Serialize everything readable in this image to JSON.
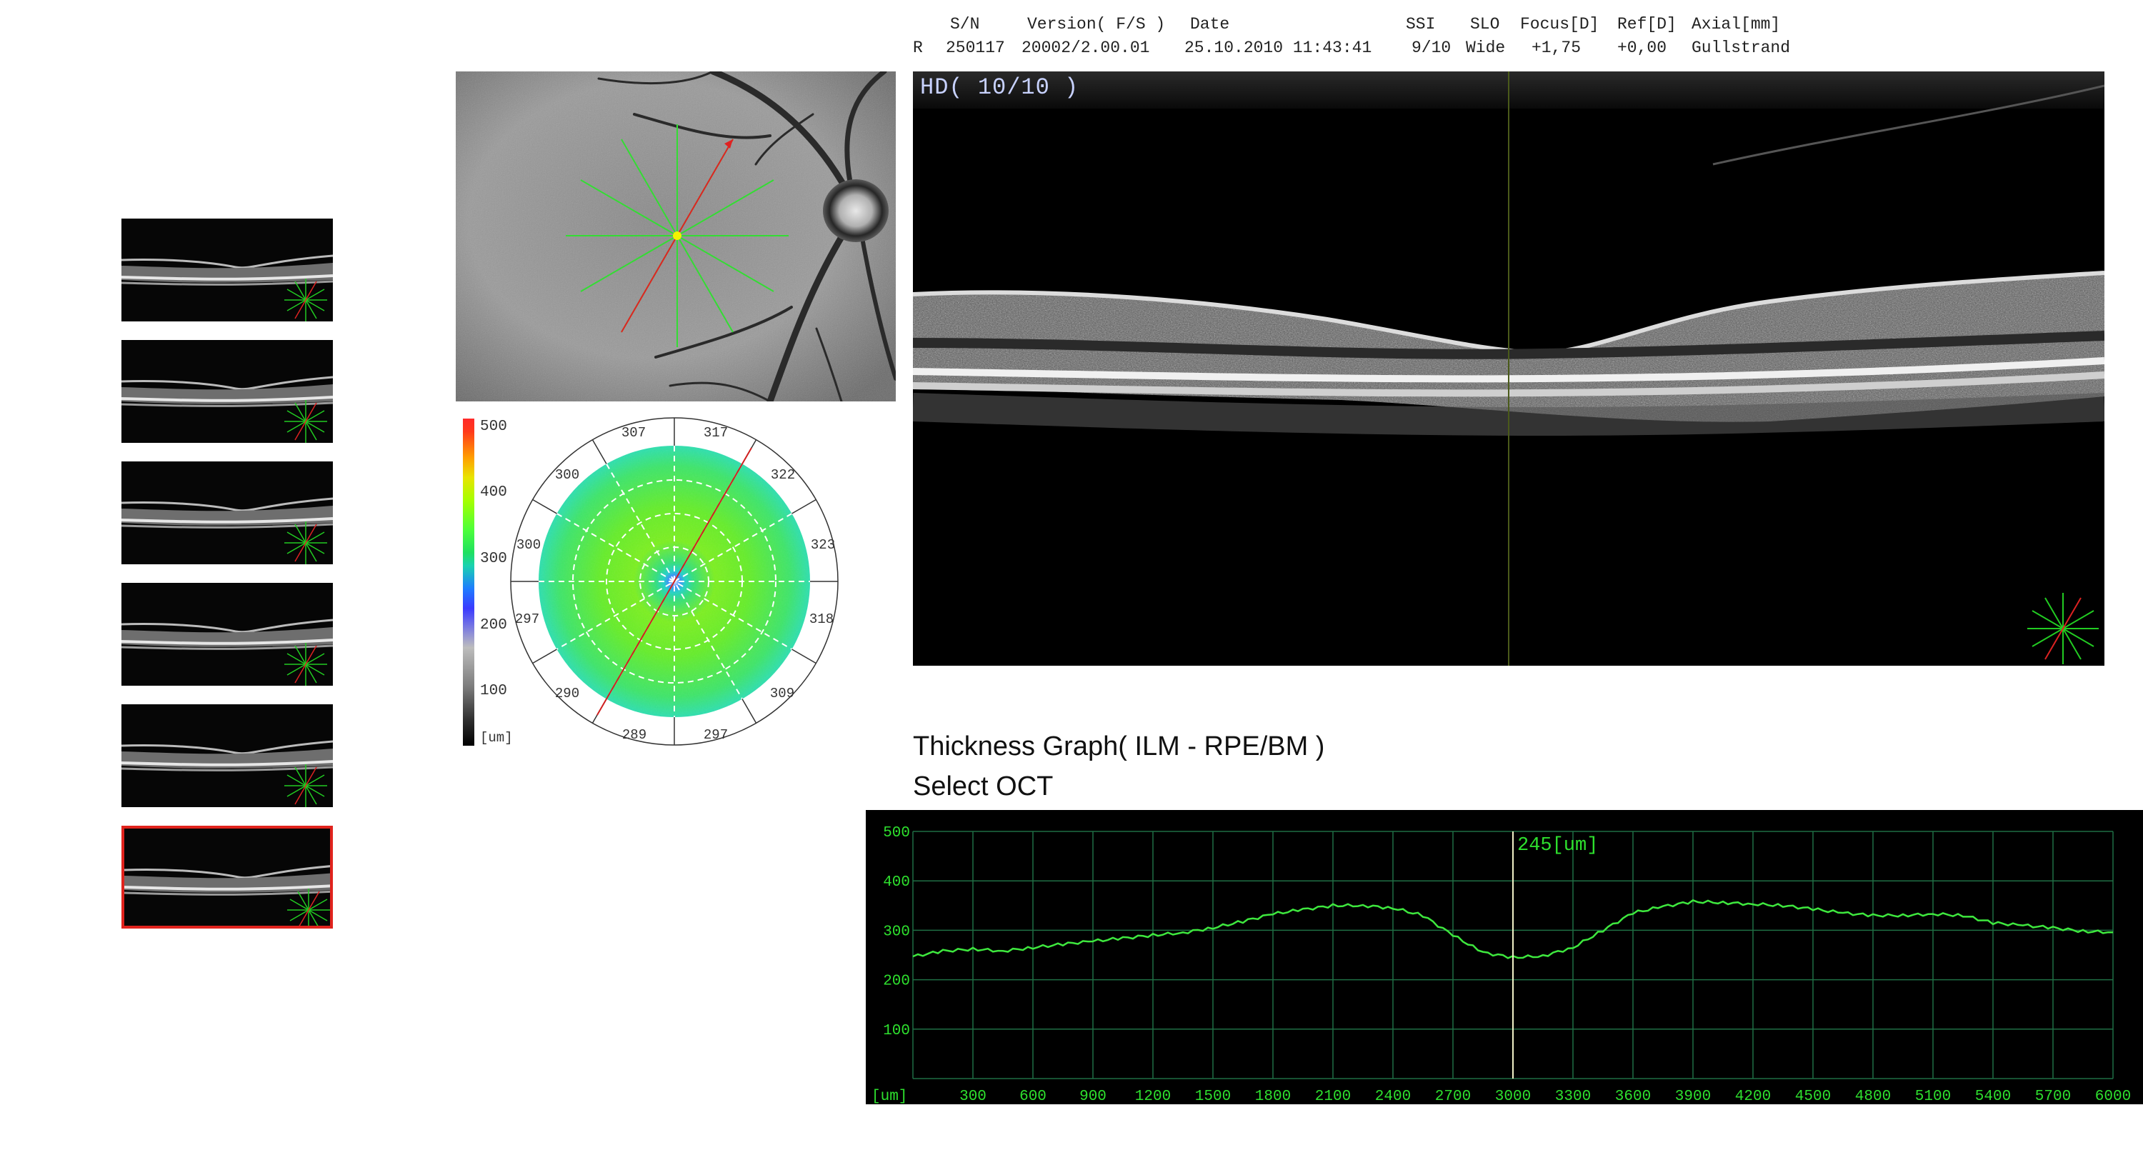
{
  "header": {
    "col_headers": [
      "S/N",
      "Version( F/S )",
      "Date",
      "SSI",
      "SLO",
      "Focus[D]",
      "Ref[D]",
      "Axial[mm]"
    ],
    "values": [
      "R",
      "250117",
      "20002/2.00.01",
      "25.10.2010 11:43:41",
      "9/10",
      "Wide",
      "+1,75",
      "+0,00",
      "Gullstrand"
    ]
  },
  "bscan": {
    "quality_label": "HD( 10/10 )"
  },
  "colorbar": {
    "labels": [
      "500",
      "400",
      "300",
      "200",
      "100",
      "[um]"
    ]
  },
  "polar_map": {
    "labels": [
      "307",
      "317",
      "322",
      "323",
      "318",
      "309",
      "297",
      "289",
      "290",
      "297",
      "300",
      "300"
    ]
  },
  "graph": {
    "title": "Thickness Graph( ILM - RPE/BM )",
    "subtitle": "Select OCT",
    "cursor_label": "245[um]"
  },
  "chart_data": {
    "type": "line",
    "x": [
      0,
      150,
      300,
      450,
      600,
      750,
      900,
      1050,
      1200,
      1350,
      1500,
      1650,
      1800,
      1950,
      2100,
      2250,
      2400,
      2550,
      2700,
      2850,
      3000,
      3150,
      3300,
      3450,
      3600,
      3750,
      3900,
      4050,
      4200,
      4350,
      4500,
      4650,
      4800,
      4950,
      5100,
      5250,
      5400,
      5550,
      5700,
      5850,
      6000
    ],
    "series": [
      {
        "values": [
          247,
          258,
          262,
          258,
          265,
          272,
          278,
          284,
          290,
          295,
          305,
          318,
          333,
          342,
          350,
          350,
          345,
          330,
          290,
          255,
          245,
          248,
          265,
          300,
          335,
          348,
          358,
          356,
          353,
          350,
          343,
          335,
          330,
          330,
          333,
          330,
          315,
          310,
          305,
          298,
          296
        ]
      }
    ],
    "xlabel": "[um]",
    "x_ticks": [
      300,
      600,
      900,
      1200,
      1500,
      1800,
      2100,
      2400,
      2700,
      3000,
      3300,
      3600,
      3900,
      4200,
      4500,
      4800,
      5100,
      5400,
      5700,
      6000
    ],
    "y_ticks": [
      100,
      200,
      300,
      400,
      500
    ],
    "xlim": [
      0,
      6000
    ],
    "ylim": [
      0,
      500
    ],
    "cursor_x": 3000,
    "grid": true,
    "line_color": "#3ee83e",
    "grid_color": "#1f6e44",
    "label_color": "#2ee02e"
  },
  "thumbnails": {
    "count": 6,
    "selected_index": 5,
    "selected_border_color": "#e0231d"
  }
}
